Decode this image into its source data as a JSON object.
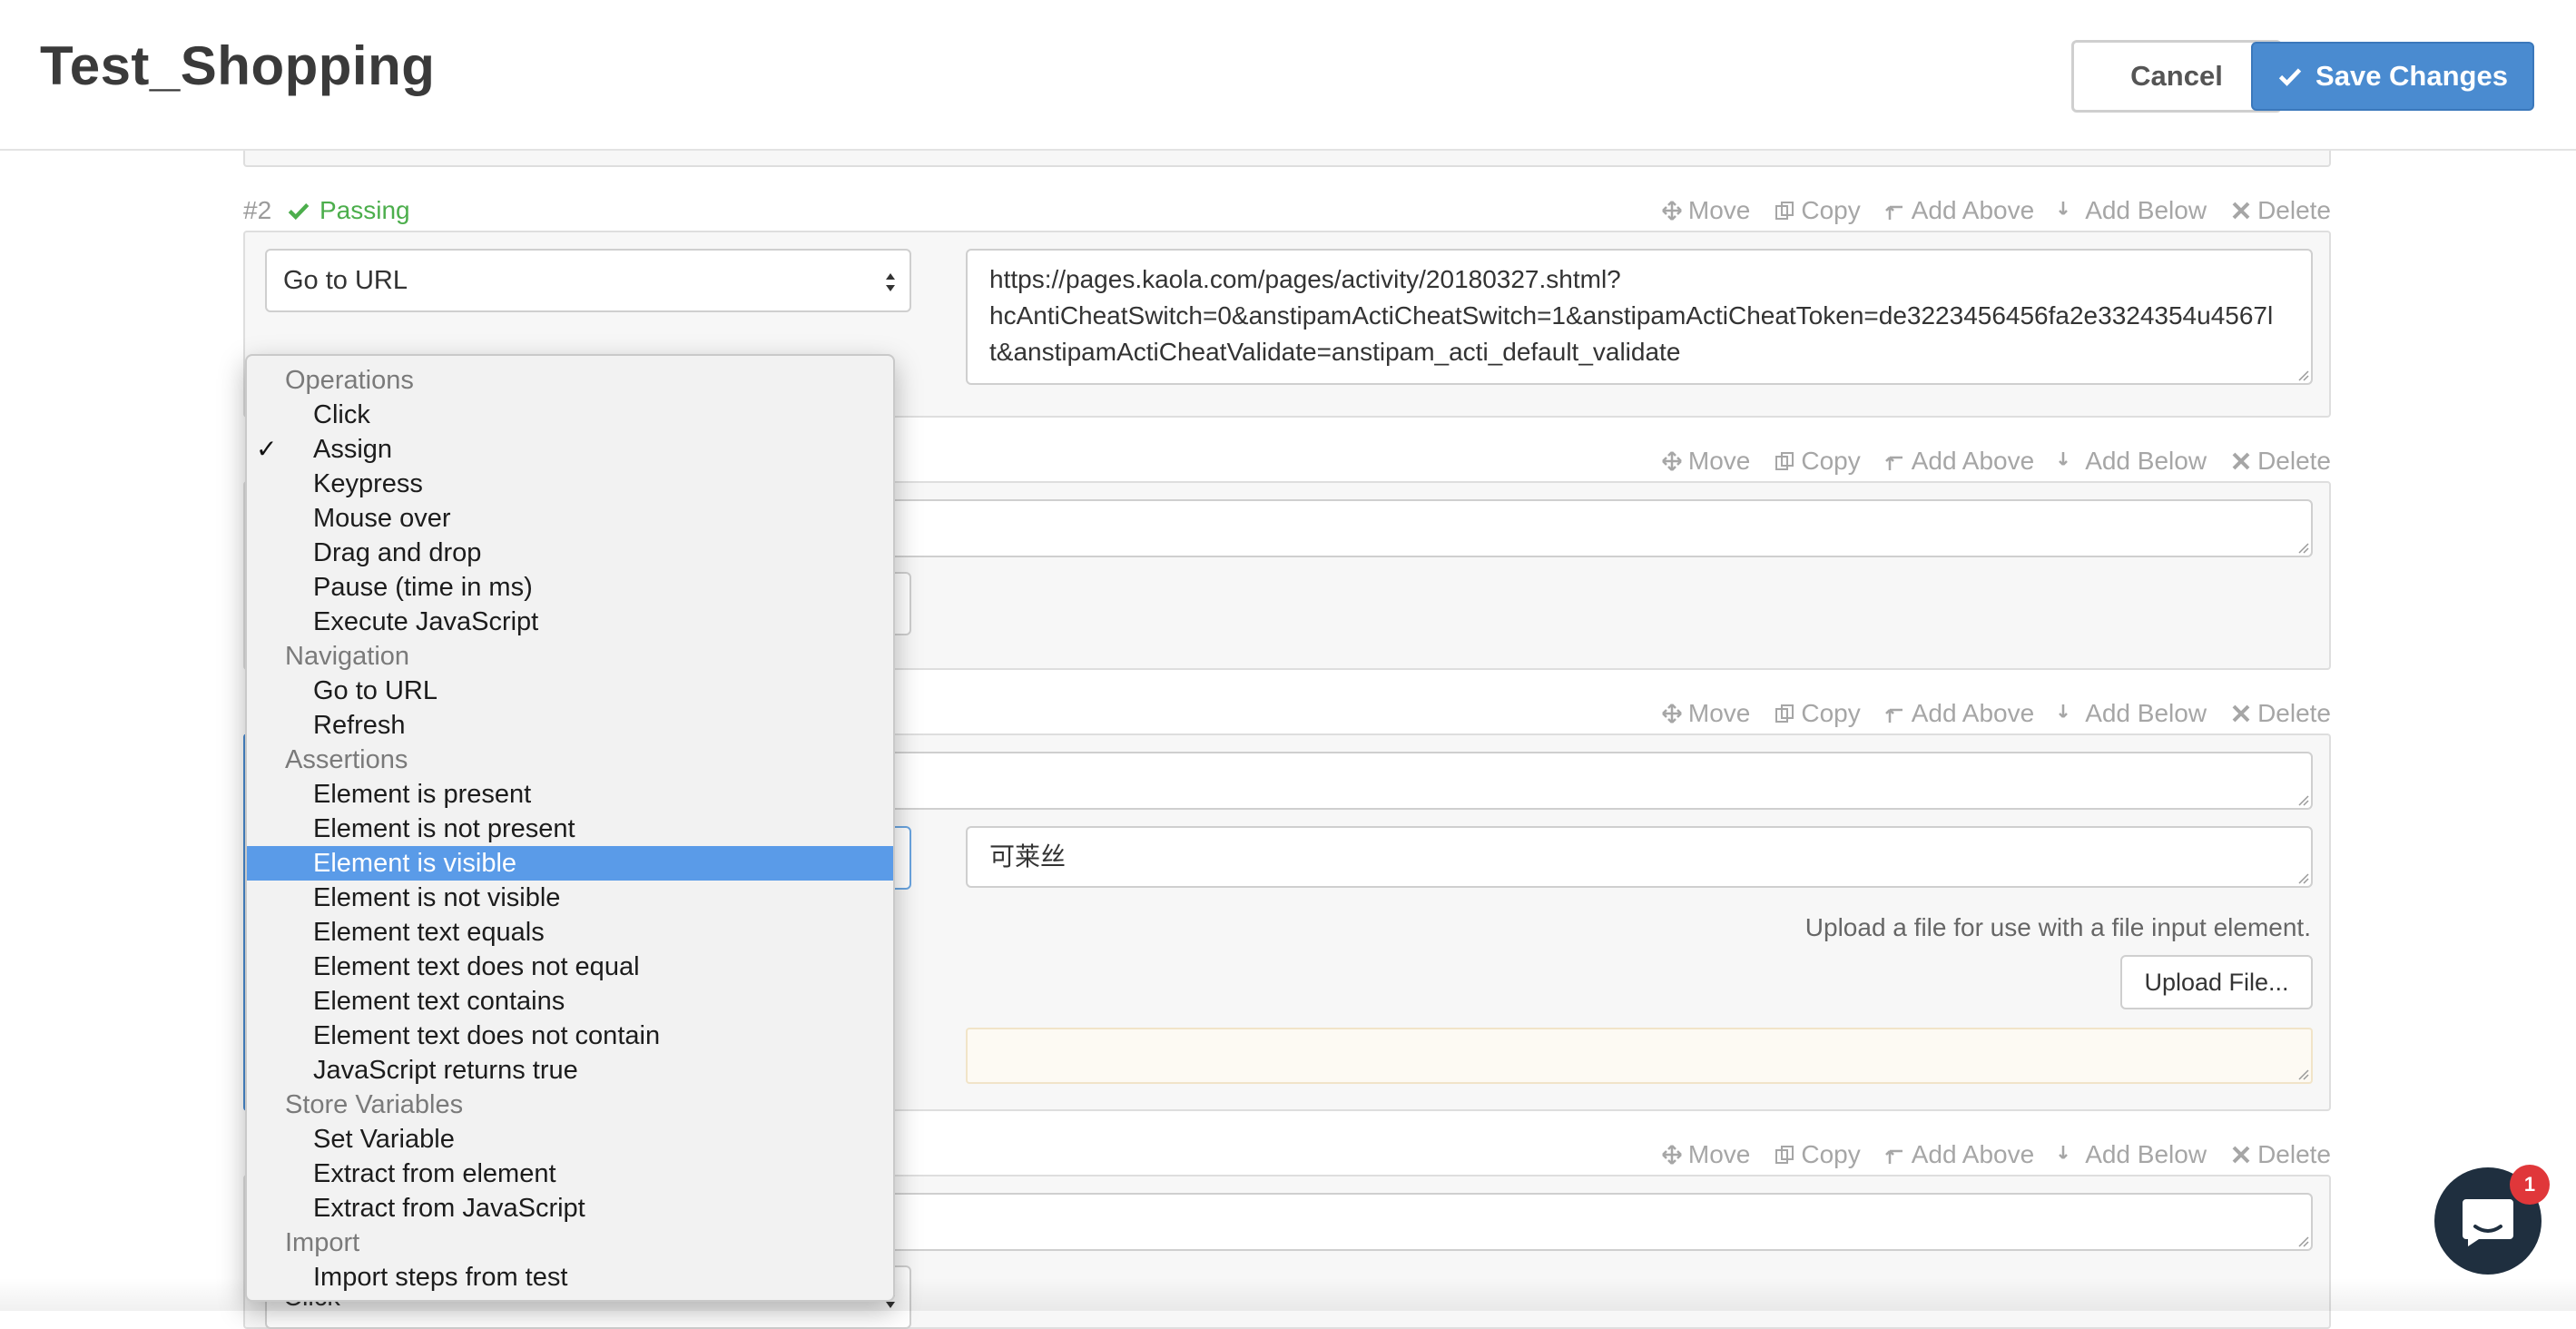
{
  "header": {
    "title": "Test_Shopping",
    "cancel_label": "Cancel",
    "save_label": "Save Changes"
  },
  "step_actions": {
    "move": "Move",
    "copy": "Copy",
    "add_above": "Add Above",
    "add_below": "Add Below",
    "delete": "Delete"
  },
  "steps": [
    {
      "number": "#2",
      "status": "Passing",
      "type": "Go to URL",
      "url_lines": [
        "https://pages.kaola.com/pages/activity/20180327.shtml?",
        "hcAntiCheatSwitch=0&anstipamActiCheatSwitch=1&anstipamActiCheatToken=de3223456456fa2e3324354u4567l",
        "t&anstipamActiCheatValidate=anstipam_acti_default_validate"
      ]
    },
    {
      "type": ""
    },
    {
      "type": "Element is visible",
      "value": "可莱丝",
      "upload_hint": "Upload a file for use with a file input element.",
      "upload_label": "Upload File..."
    },
    {
      "type": "Click"
    }
  ],
  "dropdown": {
    "items": [
      {
        "kind": "group",
        "label": "Operations"
      },
      {
        "kind": "option",
        "label": "Click"
      },
      {
        "kind": "option",
        "label": "Assign",
        "checked": true
      },
      {
        "kind": "option",
        "label": "Keypress"
      },
      {
        "kind": "option",
        "label": "Mouse over"
      },
      {
        "kind": "option",
        "label": "Drag and drop"
      },
      {
        "kind": "option",
        "label": "Pause (time in ms)"
      },
      {
        "kind": "option",
        "label": "Execute JavaScript"
      },
      {
        "kind": "group",
        "label": "Navigation"
      },
      {
        "kind": "option",
        "label": "Go to URL"
      },
      {
        "kind": "option",
        "label": "Refresh"
      },
      {
        "kind": "group",
        "label": "Assertions"
      },
      {
        "kind": "option",
        "label": "Element is present"
      },
      {
        "kind": "option",
        "label": "Element is not present"
      },
      {
        "kind": "option",
        "label": "Element is visible",
        "highlighted": true
      },
      {
        "kind": "option",
        "label": "Element is not visible"
      },
      {
        "kind": "option",
        "label": "Element text equals"
      },
      {
        "kind": "option",
        "label": "Element text does not equal"
      },
      {
        "kind": "option",
        "label": "Element text contains"
      },
      {
        "kind": "option",
        "label": "Element text does not contain"
      },
      {
        "kind": "option",
        "label": "JavaScript returns true"
      },
      {
        "kind": "group",
        "label": "Store Variables"
      },
      {
        "kind": "option",
        "label": "Set Variable"
      },
      {
        "kind": "option",
        "label": "Extract from element"
      },
      {
        "kind": "option",
        "label": "Extract from JavaScript"
      },
      {
        "kind": "group",
        "label": "Import"
      },
      {
        "kind": "option",
        "label": "Import steps from test"
      }
    ]
  },
  "chat": {
    "badge": "1"
  },
  "colors": {
    "accent": "#4a8bd0",
    "passing": "#4cae4c",
    "highlight": "#5a9be8"
  }
}
